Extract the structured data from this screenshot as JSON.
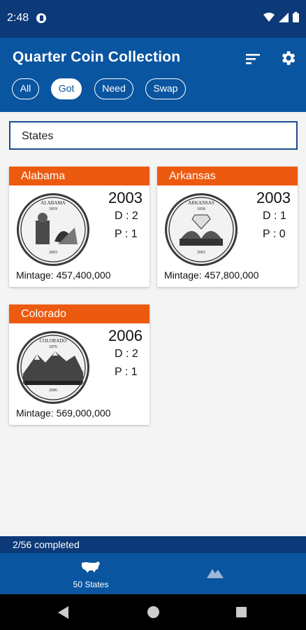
{
  "status_bar": {
    "time": "2:48",
    "icons": [
      "app-notification-icon",
      "wifi-icon",
      "signal-icon",
      "battery-icon"
    ]
  },
  "app_bar": {
    "title": "Quarter Coin Collection",
    "icons": [
      "sort-icon",
      "gear-icon"
    ],
    "filters": [
      {
        "label": "All",
        "selected": false
      },
      {
        "label": "Got",
        "selected": true
      },
      {
        "label": "Need",
        "selected": false
      },
      {
        "label": "Swap",
        "selected": false
      }
    ]
  },
  "search": {
    "value": "States"
  },
  "coins": [
    {
      "state": "Alabama",
      "year": "2003",
      "d": "D : 2",
      "p": "P : 1",
      "mintage": "Mintage: 457,400,000",
      "coin_top": "ALABAMA",
      "coin_sub": "1819",
      "coin_bottom": "2003"
    },
    {
      "state": "Arkansas",
      "year": "2003",
      "d": "D : 1",
      "p": "P : 0",
      "mintage": "Mintage: 457,800,000",
      "coin_top": "ARKANSAS",
      "coin_sub": "1836",
      "coin_bottom": "2003"
    },
    {
      "state": "Colorado",
      "year": "2006",
      "d": "D : 2",
      "p": "P : 1",
      "mintage": "Mintage: 569,000,000",
      "coin_top": "COLORADO",
      "coin_sub": "1876",
      "coin_bottom": "2006"
    }
  ],
  "progress": {
    "text": "2/56 completed"
  },
  "bottom_nav": {
    "items": [
      {
        "label": "50 States",
        "icon": "usa-map-icon",
        "selected": true
      },
      {
        "label": "",
        "icon": "mountain-icon",
        "selected": false
      }
    ]
  },
  "system_nav": {
    "icons": [
      "back-icon",
      "home-icon",
      "recents-icon"
    ]
  },
  "colors": {
    "status_bar": "#0c3a78",
    "app_bar": "#0a55a0",
    "card_header": "#ec5a10",
    "background": "#f4f4f4"
  }
}
